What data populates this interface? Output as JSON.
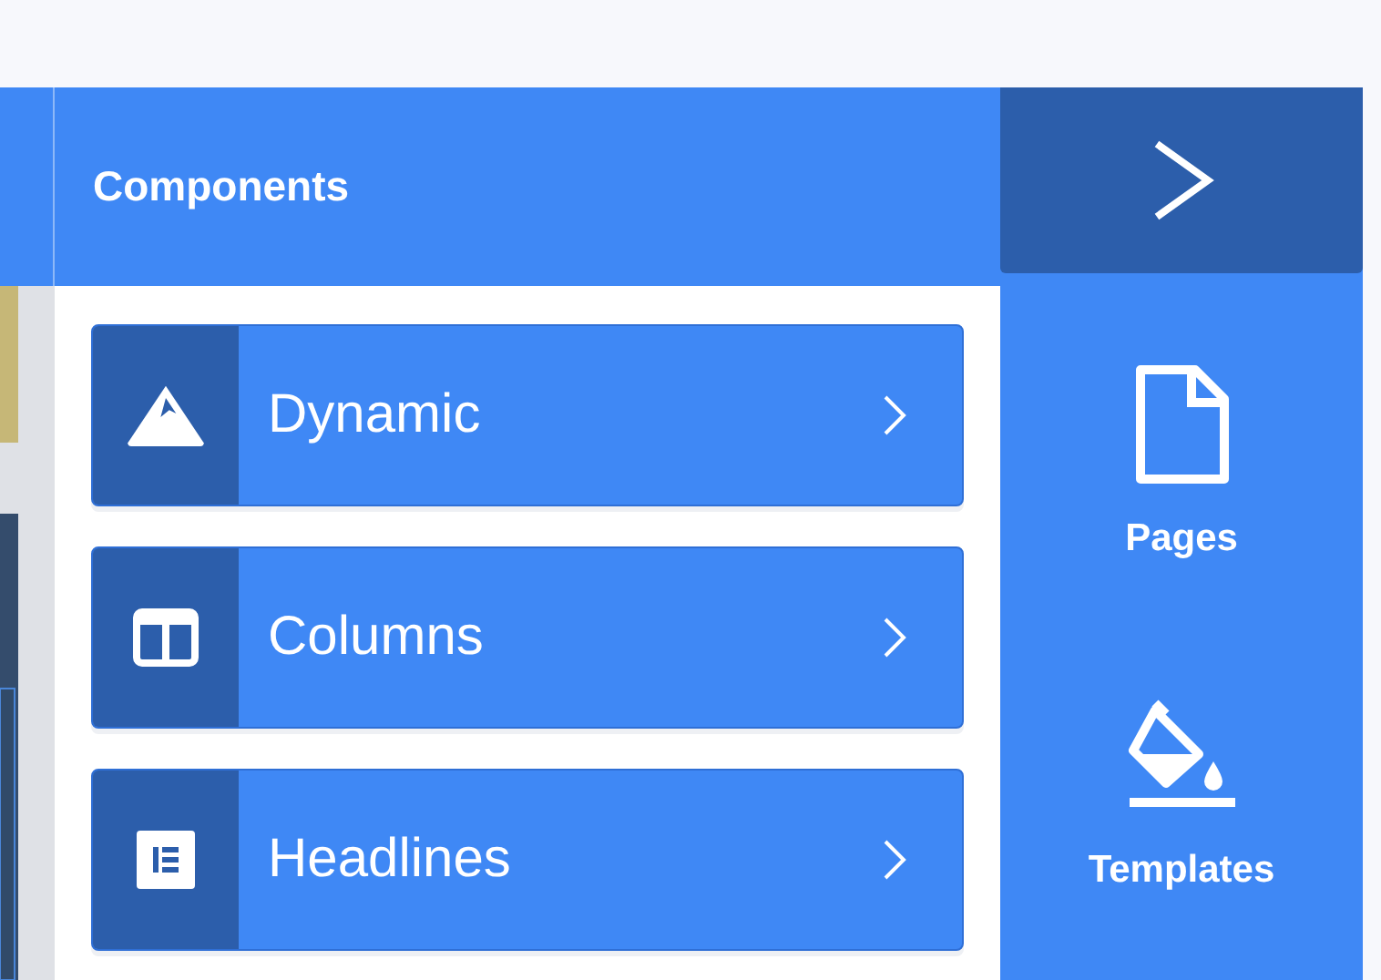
{
  "panel": {
    "title": "Components",
    "items": [
      {
        "label": "Dynamic",
        "kind": "mountain"
      },
      {
        "label": "Columns",
        "kind": "columns"
      },
      {
        "label": "Headlines",
        "kind": "text-block"
      }
    ]
  },
  "rail": {
    "items": [
      {
        "label": "Pages",
        "kind": "page"
      },
      {
        "label": "Templates",
        "kind": "paint"
      }
    ]
  }
}
